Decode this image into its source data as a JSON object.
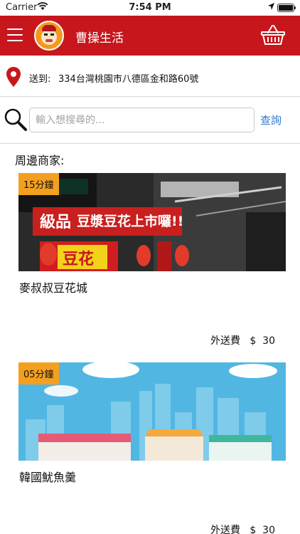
{
  "status_bar": {
    "carrier": "Carrier",
    "time": "7:54 PM"
  },
  "header": {
    "title": "曹操生活"
  },
  "address": {
    "label": "送到:",
    "value": "334台灣桃園市八德區金和路60號"
  },
  "search": {
    "placeholder": "輸入想搜尋的...",
    "button_label": "查詢"
  },
  "section": {
    "title": "周邊商家:"
  },
  "merchants": [
    {
      "eta": "15分鐘",
      "name": "麥叔叔豆花城",
      "delivery_fee_label": "外送費",
      "delivery_fee": "$  30",
      "sign_text": "豆漿豆花上市囉!!",
      "sign_text_2": "豆花",
      "sign_text_3": "級品"
    },
    {
      "eta": "05分鐘",
      "name": "韓國魷魚羹",
      "delivery_fee_label": "外送費",
      "delivery_fee": "$  30"
    }
  ],
  "colors": {
    "brand_red": "#c8161d",
    "badge_orange": "#f4a01f",
    "link_blue": "#2b7cd3"
  },
  "icons": [
    "wifi-icon",
    "location-arrow-icon",
    "battery-icon",
    "menu-icon",
    "logo",
    "basket-icon",
    "map-pin-icon",
    "search-icon"
  ]
}
